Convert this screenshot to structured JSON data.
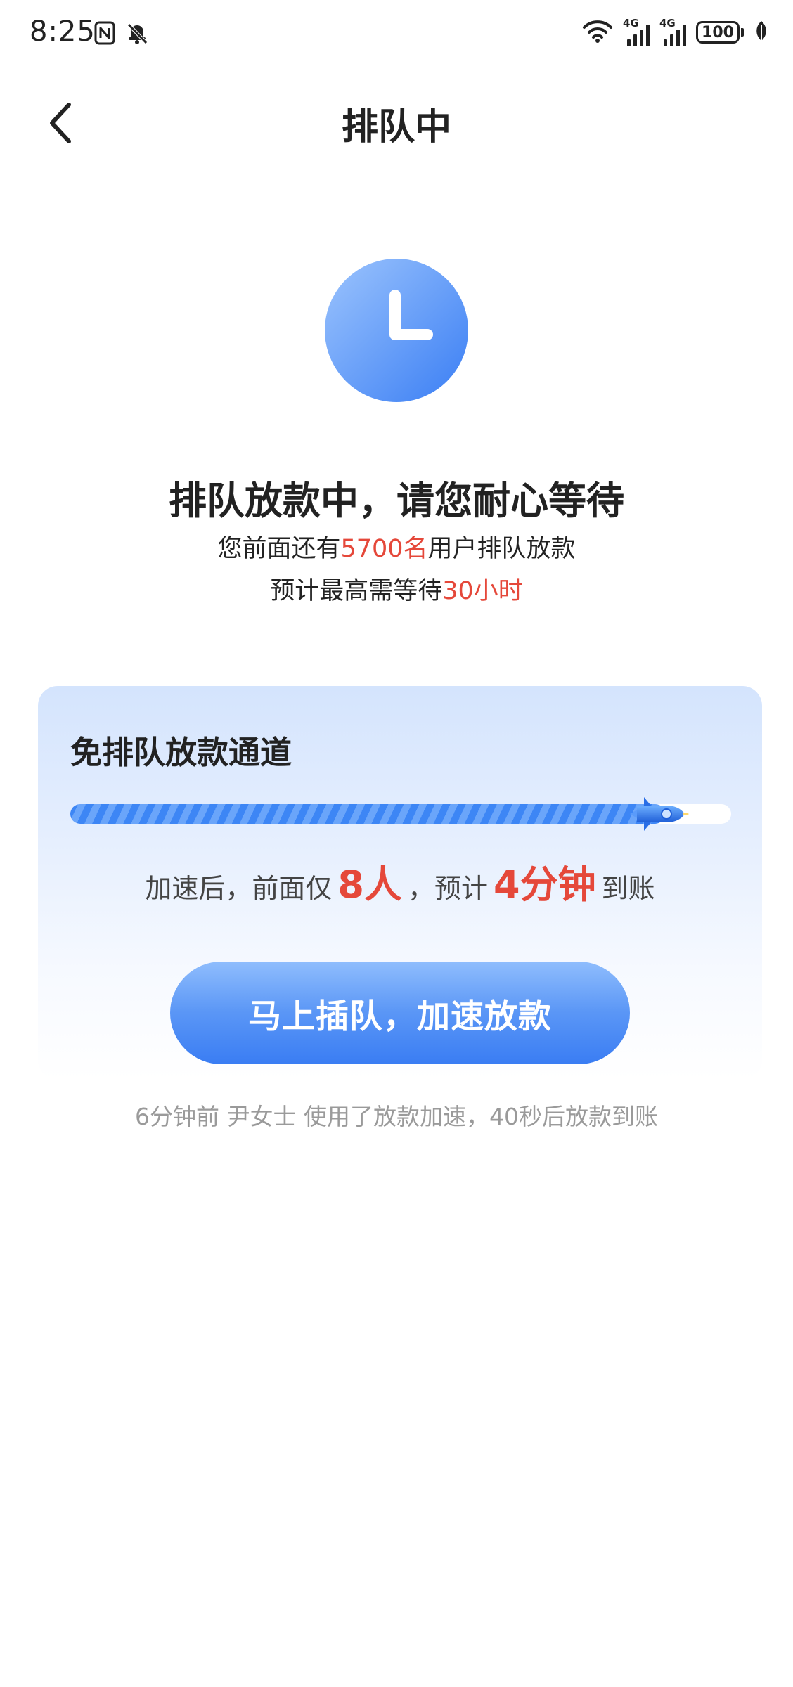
{
  "status_bar": {
    "time": "8:25",
    "network_label_1": "4G",
    "network_label_2": "4G",
    "battery_level": "100",
    "icons": [
      "nfc-icon",
      "bell-muted-icon",
      "wifi-icon",
      "signal-icon",
      "battery-icon",
      "leaf-icon"
    ]
  },
  "nav": {
    "title": "排队中",
    "back_icon": "chevron-left-icon"
  },
  "queue": {
    "headline": "排队放款中，请您耐心等待",
    "ahead_prefix": "您前面还有",
    "ahead_count": "5700名",
    "ahead_suffix": "用户排队放款",
    "eta_prefix": "预计最高需等待",
    "eta_value": "30小时"
  },
  "fast_lane": {
    "title": "免排队放款通道",
    "progress_fraction": 0.9,
    "text_1": "加速后，前面仅",
    "people_value": "8人",
    "text_2": "，预计",
    "time_value": "4分钟",
    "text_3": "到账",
    "button_label": "马上插队，加速放款"
  },
  "footer_note": "6分钟前 尹女士 使用了放款加速，40秒后放款到账",
  "colors": {
    "accent_blue": "#3d86f5",
    "highlight_red": "#e5483a",
    "muted_gray": "#9a9a9a"
  }
}
